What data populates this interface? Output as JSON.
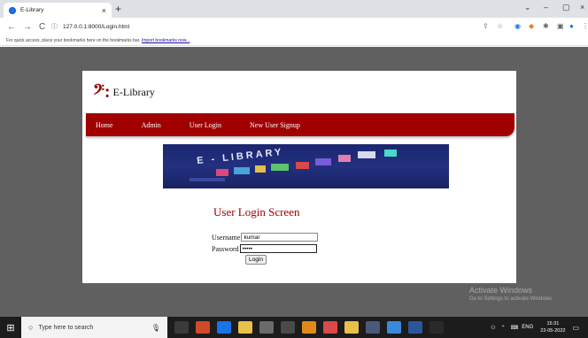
{
  "browser": {
    "tab_title": "E-Library",
    "tab_close": "×",
    "new_tab": "+",
    "url": "127.0.0.1:8000/Login.html",
    "window_controls": [
      "⌄",
      "–",
      "▢",
      "×"
    ],
    "bookmarks_text": "For quick access, place your bookmarks here on the bookmarks bar.",
    "bookmarks_link": "Import bookmarks now..."
  },
  "page": {
    "logo_mark": "𝄢:",
    "logo_text": "E-Library",
    "nav": [
      "Home",
      "Admin",
      "User Login",
      "New User Signup"
    ],
    "banner_text": "E - LIBRARY",
    "login_title": "User Login Screen",
    "username_label": "Username",
    "username_value": "kumar",
    "password_label": "Password",
    "password_value": "•••••",
    "login_button": "Login"
  },
  "watermark": {
    "line1": "Activate Windows",
    "line2": "Go to Settings to activate Windows."
  },
  "taskbar": {
    "search_placeholder": "Type here to search",
    "time": "15:31",
    "date": "22-05-2022",
    "tray_text": "ENG"
  },
  "colors": {
    "brand_red": "#a00000",
    "page_bg": "#606060",
    "banner_blue": "#1b2670"
  }
}
